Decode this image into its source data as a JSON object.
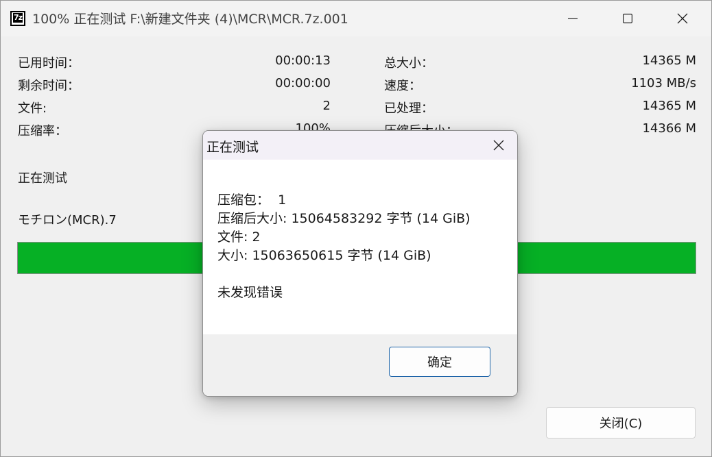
{
  "window": {
    "title": "100% 正在测试 F:\\新建文件夹 (4)\\MCR\\MCR.7z.001",
    "icon_label": "7z"
  },
  "stats_left": [
    {
      "label": "已用时间：",
      "value": "00:00:13"
    },
    {
      "label": "剩余时间：",
      "value": "00:00:00"
    },
    {
      "label": "文件:",
      "value": "2"
    },
    {
      "label": "压缩率：",
      "value": "100%"
    }
  ],
  "stats_right": [
    {
      "label": "总大小：",
      "value": "14365 M"
    },
    {
      "label": "速度：",
      "value": "1103 MB/s"
    },
    {
      "label": "已处理：",
      "value": "14365 M"
    },
    {
      "label": "压缩后大小：",
      "value": "14366 M"
    }
  ],
  "status": {
    "operation": "正在测试",
    "current_file": "モチロン(MCR).7"
  },
  "progress": {
    "fraction": 1.0,
    "color": "#06b025"
  },
  "main_buttons": {
    "close_label": "关闭(C)"
  },
  "dialog": {
    "title": "正在测试",
    "lines": [
      "压缩包：  1",
      "压缩后大小: 15064583292 字节 (14 GiB)",
      "文件: 2",
      "大小: 15063650615 字节 (14 GiB)"
    ],
    "result": "未发现错误",
    "ok_label": "确定"
  }
}
